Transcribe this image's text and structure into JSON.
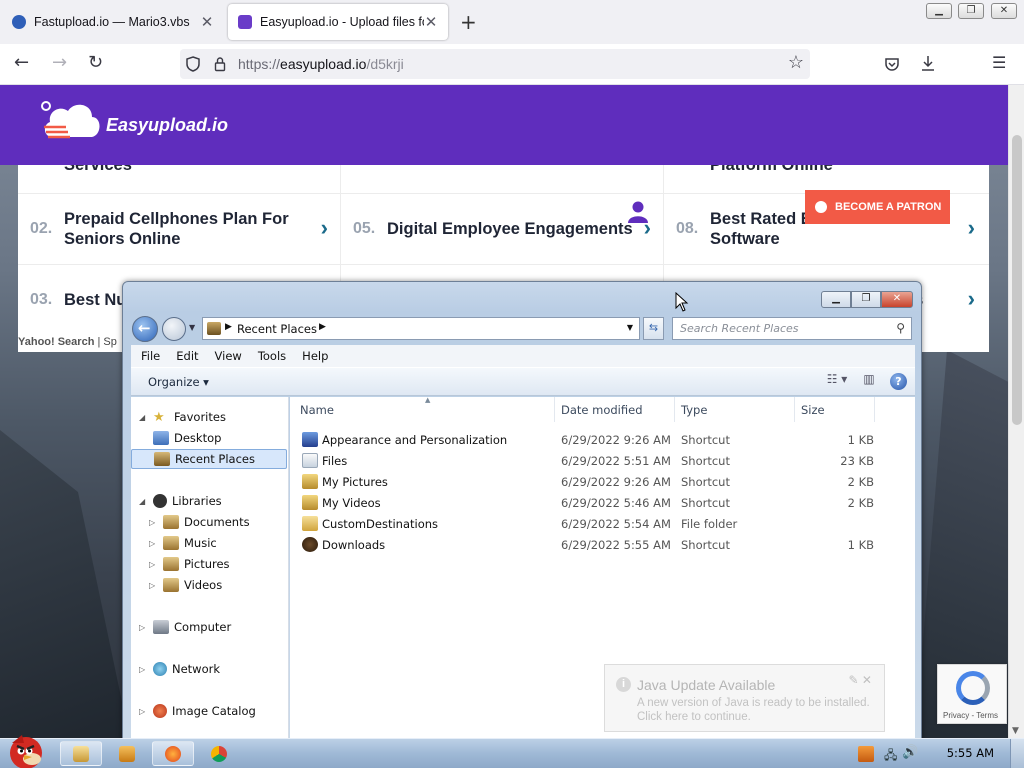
{
  "browser": {
    "tabs": [
      {
        "title": "Fastupload.io — Mario3.vbs",
        "active": false
      },
      {
        "title": "Easyupload.io - Upload files for",
        "active": true
      }
    ],
    "url_prefix": "https://",
    "url_host": "easyupload.io",
    "url_path": "/d5krji",
    "new_tab_label": "+"
  },
  "site": {
    "logo_text": "Easyupload.io",
    "top_row": [
      {
        "text": "Services"
      },
      {
        "text": ""
      },
      {
        "text": "Platform Online"
      }
    ],
    "row_mid": [
      {
        "num": "02.",
        "text_line1": "Prepaid Cellphones Plan For",
        "text_line2": "Seniors Online"
      },
      {
        "num": "05.",
        "text_line1": "Digital Employee Engagements",
        "text_line2": ""
      },
      {
        "num": "08.",
        "text_line1": "Best Rated E",
        "text_line2": "Software"
      }
    ],
    "row_bottom": [
      {
        "num": "03.",
        "text": "Best Nu"
      },
      {
        "num": "",
        "text": ""
      },
      {
        "num": "",
        "text": "ons"
      }
    ],
    "patron_button": "BECOME A PATRON",
    "yahoo_label": "Yahoo! Search",
    "yahoo_sep": "| Sp",
    "accent_color": "#5f2dbd",
    "patron_color": "#f25a46"
  },
  "explorer": {
    "breadcrumb": "Recent Places",
    "search_placeholder": "Search Recent Places",
    "menu": [
      "File",
      "Edit",
      "View",
      "Tools",
      "Help"
    ],
    "organize_label": "Organize",
    "nav": {
      "favorites": "Favorites",
      "desktop": "Desktop",
      "recent_places": "Recent Places",
      "libraries": "Libraries",
      "documents": "Documents",
      "music": "Music",
      "pictures": "Pictures",
      "videos": "Videos",
      "computer": "Computer",
      "network": "Network",
      "image_catalog": "Image Catalog"
    },
    "columns": [
      "Name",
      "Date modified",
      "Type",
      "Size"
    ],
    "files": [
      {
        "name": "Appearance and Personalization",
        "date": "6/29/2022 9:26 AM",
        "type": "Shortcut",
        "size": "1 KB",
        "icon": "control-panel-icon"
      },
      {
        "name": "Files",
        "date": "6/29/2022 5:51 AM",
        "type": "Shortcut",
        "size": "23 KB",
        "icon": "file-icon"
      },
      {
        "name": "My Pictures",
        "date": "6/29/2022 9:26 AM",
        "type": "Shortcut",
        "size": "2 KB",
        "icon": "pictures-folder-icon"
      },
      {
        "name": "My Videos",
        "date": "6/29/2022 5:46 AM",
        "type": "Shortcut",
        "size": "2 KB",
        "icon": "videos-folder-icon"
      },
      {
        "name": "CustomDestinations",
        "date": "6/29/2022 5:54 AM",
        "type": "File folder",
        "size": "",
        "icon": "folder-icon"
      },
      {
        "name": "Downloads",
        "date": "6/29/2022 5:55 AM",
        "type": "Shortcut",
        "size": "1 KB",
        "icon": "downloads-icon"
      }
    ]
  },
  "java_notification": {
    "title": "Java Update Available",
    "line1": "A new version of Java is ready to be installed.",
    "line2": "Click here to continue."
  },
  "recaptcha": {
    "privacy": "Privacy",
    "sep": " - ",
    "terms": "Terms"
  },
  "taskbar": {
    "clock": "5:55 AM"
  }
}
